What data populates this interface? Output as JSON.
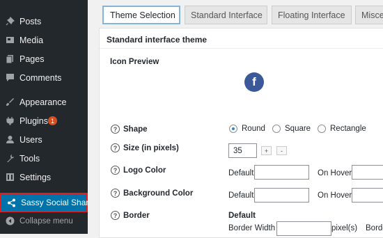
{
  "sidebar": {
    "items": [
      {
        "label": "Posts",
        "icon": "pin-icon"
      },
      {
        "label": "Media",
        "icon": "media-icon"
      },
      {
        "label": "Pages",
        "icon": "pages-icon"
      },
      {
        "label": "Comments",
        "icon": "comments-icon"
      },
      {
        "label": "Appearance",
        "icon": "appearance-icon"
      },
      {
        "label": "Plugins",
        "icon": "plugins-icon",
        "badge": "1"
      },
      {
        "label": "Users",
        "icon": "users-icon"
      },
      {
        "label": "Tools",
        "icon": "tools-icon"
      },
      {
        "label": "Settings",
        "icon": "settings-icon"
      },
      {
        "label": "Sassy Social Share",
        "icon": "share-icon"
      }
    ],
    "collapse_label": "Collapse menu"
  },
  "tabs": [
    "Theme Selection",
    "Standard Interface",
    "Floating Interface",
    "Misce"
  ],
  "panel": {
    "title": "Standard interface theme",
    "icon_preview_label": "Icon Preview",
    "icon_preview_glyph": "f",
    "shape": {
      "label": "Shape",
      "options": [
        "Round",
        "Square",
        "Rectangle"
      ],
      "selected": "Round"
    },
    "size": {
      "label": "Size (in pixels)",
      "value": "35",
      "plus": "+",
      "minus": "-"
    },
    "logo_color": {
      "label": "Logo Color",
      "default_label": "Default",
      "hover_label": "On Hover"
    },
    "background_color": {
      "label": "Background Color",
      "default_label": "Default",
      "hover_label": "On Hover"
    },
    "border": {
      "label": "Border",
      "default_label": "Default",
      "width_label": "Border Width",
      "unit": "pixel(s)",
      "next_label": "Borde"
    }
  },
  "colors": {
    "accent": "#0073aa",
    "sidebar_bg": "#23282d",
    "facebook": "#3b5998",
    "highlight_border": "#e02020"
  }
}
